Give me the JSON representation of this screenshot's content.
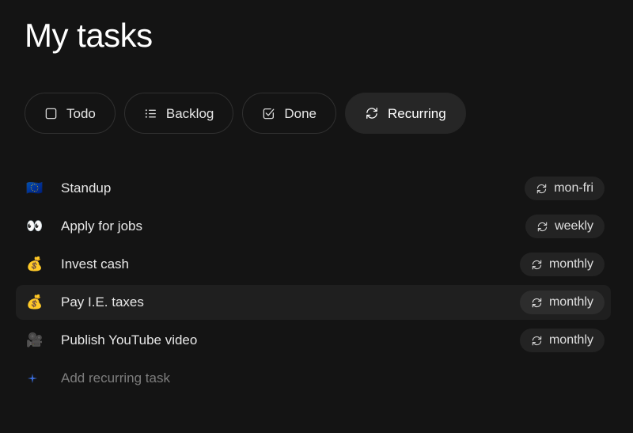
{
  "header": {
    "title": "My tasks"
  },
  "tabs": [
    {
      "label": "Todo",
      "icon": "checkbox-empty-icon",
      "selected": false
    },
    {
      "label": "Backlog",
      "icon": "list-icon",
      "selected": false
    },
    {
      "label": "Done",
      "icon": "checkbox-checked-icon",
      "selected": false
    },
    {
      "label": "Recurring",
      "icon": "recurring-icon",
      "selected": true
    }
  ],
  "tasks": [
    {
      "emoji": "🇪🇺",
      "emoji_name": "european-union-flag-emoji",
      "name": "Standup",
      "badge": "mon-fri",
      "badge_icon": "recurring-icon",
      "active": false
    },
    {
      "emoji": "👀",
      "emoji_name": "eyes-emoji",
      "name": "Apply for jobs",
      "badge": "weekly",
      "badge_icon": "recurring-icon",
      "active": false
    },
    {
      "emoji": "💰",
      "emoji_name": "money-bag-emoji",
      "name": "Invest cash",
      "badge": "monthly",
      "badge_icon": "recurring-icon",
      "active": false
    },
    {
      "emoji": "💰",
      "emoji_name": "money-bag-emoji",
      "name": "Pay I.E. taxes",
      "badge": "monthly",
      "badge_icon": "recurring-icon",
      "active": true
    },
    {
      "emoji": "🎥",
      "emoji_name": "movie-camera-emoji",
      "name": "Publish YouTube video",
      "badge": "monthly",
      "badge_icon": "recurring-icon",
      "active": false
    }
  ],
  "add_task": {
    "label": "Add recurring task",
    "icon": "plus-icon"
  },
  "colors": {
    "background": "#141414",
    "row_active": "#1f1f1f",
    "tab_selected": "#262626",
    "tab_border": "#303030",
    "badge": "#232323",
    "text": "#e8e8e8",
    "text_muted": "#7d7d7d",
    "accent": "#3b6fe0"
  }
}
